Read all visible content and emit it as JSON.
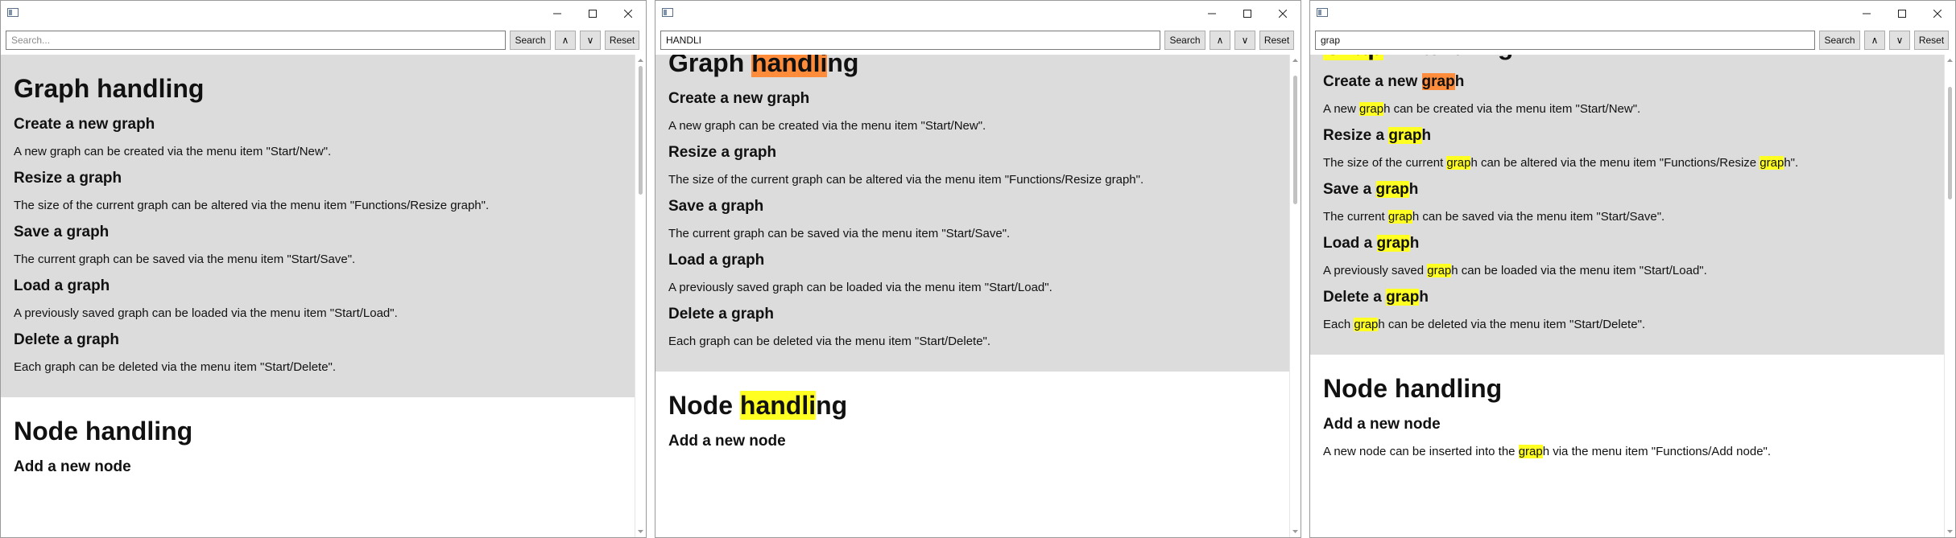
{
  "windows": [
    {
      "search": {
        "value": "",
        "placeholder": "Search..."
      },
      "buttons": {
        "search": "Search",
        "prev": "∧",
        "next": "∨",
        "reset": "Reset"
      },
      "query": "",
      "current_match": -1,
      "sections": [
        {
          "title": "Graph handling",
          "shaded": true,
          "items": [
            {
              "heading": "Create a new graph",
              "text": "A new graph can be created via the menu item \"Start/New\"."
            },
            {
              "heading": "Resize a graph",
              "text": "The size of the current graph can be altered via the menu item \"Functions/Resize graph\"."
            },
            {
              "heading": "Save a graph",
              "text": "The current graph can be saved via the menu item \"Start/Save\"."
            },
            {
              "heading": "Load a graph",
              "text": "A previously saved graph can be loaded via the menu item \"Start/Load\"."
            },
            {
              "heading": "Delete a graph",
              "text": "Each graph can be deleted via the menu item \"Start/Delete\"."
            }
          ]
        },
        {
          "title": "Node handling",
          "shaded": false,
          "items": [
            {
              "heading": "Add a new node",
              "text": ""
            }
          ]
        }
      ]
    },
    {
      "search": {
        "value": "HANDLI",
        "placeholder": "Search..."
      },
      "buttons": {
        "search": "Search",
        "prev": "∧",
        "next": "∨",
        "reset": "Reset"
      },
      "query": "handli",
      "current_match": 0,
      "sections": [
        {
          "title": "Graph handling",
          "shaded": true,
          "items": [
            {
              "heading": "Create a new graph",
              "text": "A new graph can be created via the menu item \"Start/New\"."
            },
            {
              "heading": "Resize a graph",
              "text": "The size of the current graph can be altered via the menu item \"Functions/Resize graph\"."
            },
            {
              "heading": "Save a graph",
              "text": "The current graph can be saved via the menu item \"Start/Save\"."
            },
            {
              "heading": "Load a graph",
              "text": "A previously saved graph can be loaded via the menu item \"Start/Load\"."
            },
            {
              "heading": "Delete a graph",
              "text": "Each graph can be deleted via the menu item \"Start/Delete\"."
            }
          ]
        },
        {
          "title": "Node handling",
          "shaded": false,
          "items": [
            {
              "heading": "Add a new node",
              "text": ""
            }
          ]
        }
      ]
    },
    {
      "search": {
        "value": "grap",
        "placeholder": "Search..."
      },
      "buttons": {
        "search": "Search",
        "prev": "∧",
        "next": "∨",
        "reset": "Reset"
      },
      "query": "grap",
      "current_match": 1,
      "sections": [
        {
          "title": "Graph handling",
          "shaded": true,
          "items": [
            {
              "heading": "Create a new graph",
              "text": "A new graph can be created via the menu item \"Start/New\"."
            },
            {
              "heading": "Resize a graph",
              "text": "The size of the current graph can be altered via the menu item \"Functions/Resize graph\"."
            },
            {
              "heading": "Save a graph",
              "text": "The current graph can be saved via the menu item \"Start/Save\"."
            },
            {
              "heading": "Load a graph",
              "text": "A previously saved graph can be loaded via the menu item \"Start/Load\"."
            },
            {
              "heading": "Delete a graph",
              "text": "Each graph can be deleted via the menu item \"Start/Delete\"."
            }
          ]
        },
        {
          "title": "Node handling",
          "shaded": false,
          "items": [
            {
              "heading": "Add a new node",
              "text": "A new node can be inserted into the graph via the menu item \"Functions/Add node\"."
            }
          ]
        }
      ]
    }
  ],
  "colors": {
    "highlight": "#ffff22",
    "current_highlight": "#ff8c3a",
    "section_shade": "#dcdcdc"
  }
}
